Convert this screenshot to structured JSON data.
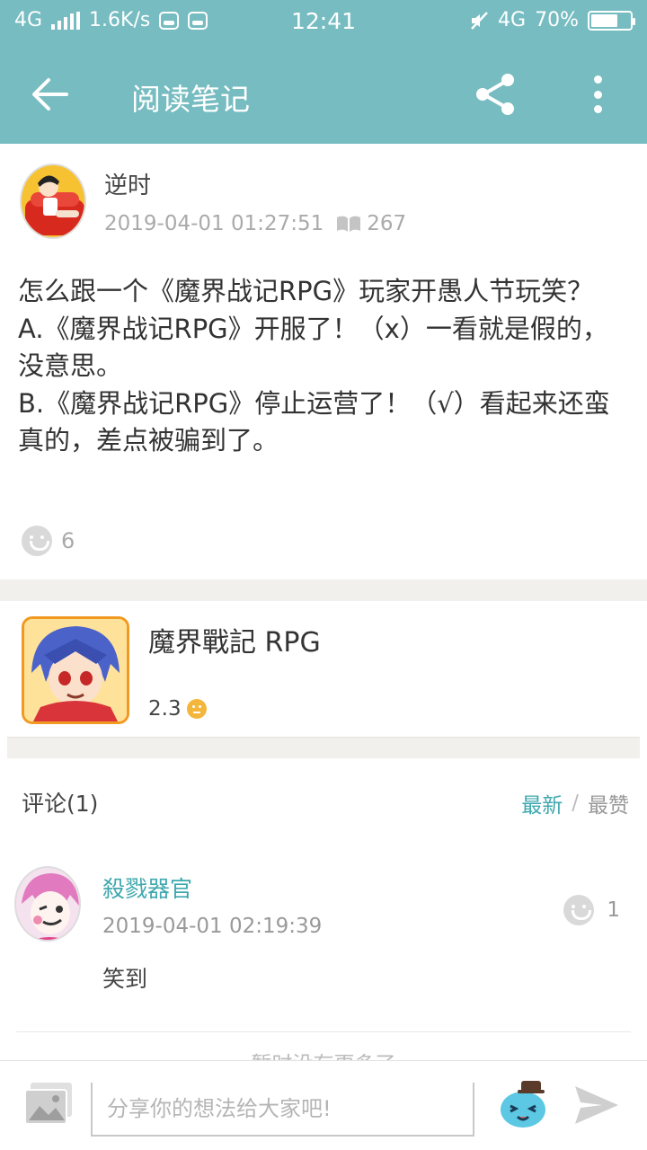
{
  "status_bar": {
    "network": "4G",
    "speed": "1.6K/s",
    "time": "12:41",
    "network_right": "4G",
    "battery_percent": "70%",
    "battery_level": 0.7
  },
  "app_bar": {
    "title": "阅读笔记",
    "back_icon": "arrow-left-icon",
    "share_icon": "share-icon",
    "more_icon": "more-vertical-icon",
    "color": "#76bcc1"
  },
  "post": {
    "author": "逆时",
    "datetime": "2019-04-01 01:27:51",
    "read_count": "267",
    "paragraphs": [
      "怎么跟一个《魔界战记RPG》玩家开愚人节玩笑？",
      "A.《魔界战记RPG》开服了！（x）一看就是假的，没意思。",
      "B.《魔界战记RPG》停止运营了！（√）看起来还蛮真的，差点被骗到了。"
    ],
    "likes": "6"
  },
  "game": {
    "name": "魔界戰記 RPG",
    "rating": "2.3"
  },
  "comments": {
    "title": "评论(1)",
    "sort_latest": "最新",
    "sort_separator": "/",
    "sort_top": "最赞",
    "items": [
      {
        "author": "殺戮器官",
        "datetime": "2019-04-01 02:19:39",
        "likes": "1",
        "text": "笑到"
      }
    ],
    "footer_hint": "—— 暂时没有更多了 ——"
  },
  "input_bar": {
    "placeholder": "分享你的想法给大家吧!"
  },
  "colors": {
    "accent": "#3fa8ae",
    "separator": "#f1f0ec"
  }
}
